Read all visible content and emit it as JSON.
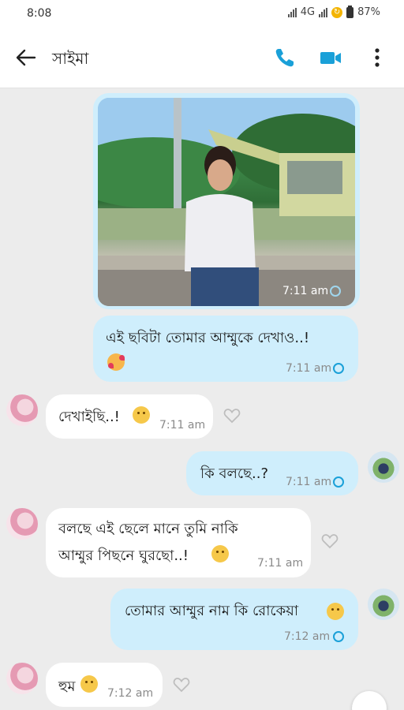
{
  "status_bar": {
    "time": "8:08",
    "network": "4G",
    "battery": "87%"
  },
  "header": {
    "contact_name": "সাইমা",
    "icons": [
      "arrow-left-icon",
      "phone-icon",
      "video-icon",
      "more-vertical-icon"
    ]
  },
  "colors": {
    "accent": "#1aa0d8",
    "sent_bubble": "#cfeefc",
    "received_bubble": "#ffffff",
    "background": "#ececec"
  },
  "messages": [
    {
      "direction": "sent",
      "type": "image",
      "time": "7:11 am"
    },
    {
      "direction": "sent",
      "text": "এই ছবিটা তোমার আম্মুকে দেখাও..!",
      "emoji": "smiling-face-with-hearts",
      "time": "7:11 am"
    },
    {
      "direction": "received",
      "text": "দেখাইছি..!",
      "emoji": "disappointed-face",
      "time": "7:11 am"
    },
    {
      "direction": "sent",
      "text": "কি বলছে..?",
      "time": "7:11 am"
    },
    {
      "direction": "received",
      "lines": [
        "বলছে এই ছেলে মানে তুমি নাকি",
        "আম্মুর পিছনে ঘুরছো..!"
      ],
      "emoji": "thinking-face",
      "time": "7:11 am"
    },
    {
      "direction": "sent",
      "text": "তোমার আম্মুর নাম কি রোকেয়া",
      "emoji": "pleading-face",
      "time": "7:12 am"
    },
    {
      "direction": "received",
      "text": "হুম",
      "emoji": "slightly-smiling-face",
      "time": "7:12 am"
    }
  ]
}
